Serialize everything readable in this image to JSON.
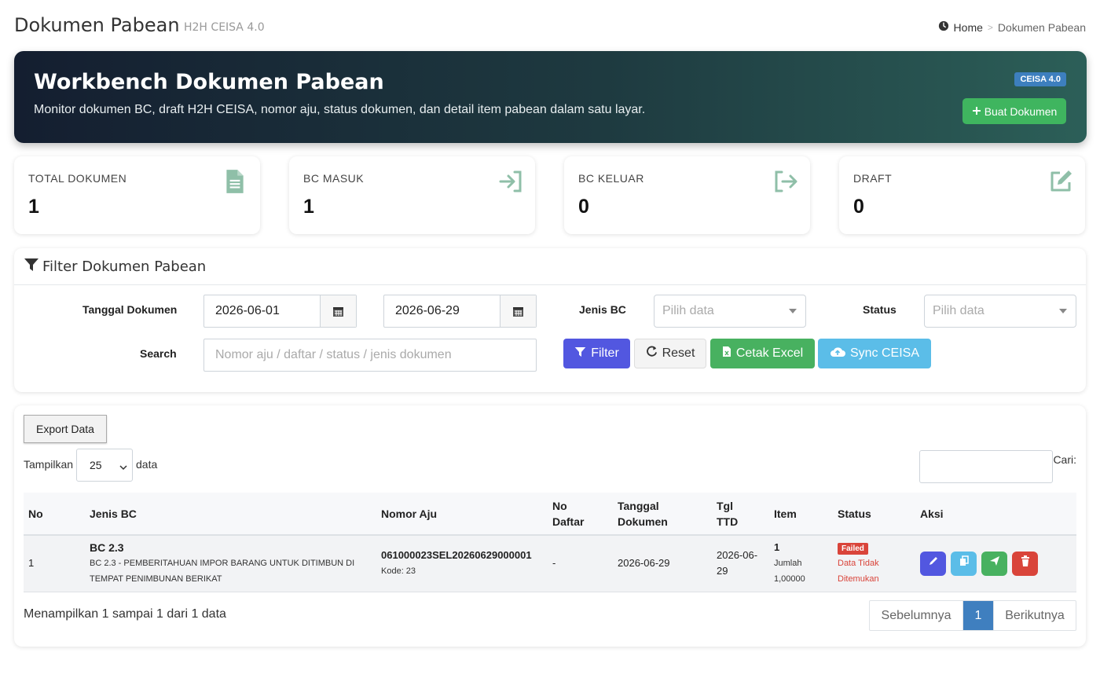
{
  "header": {
    "title": "Dokumen Pabean",
    "subtitle": "H2H CEISA 4.0",
    "breadcrumb_home": "Home",
    "breadcrumb_current": "Dokumen Pabean"
  },
  "hero": {
    "title": "Workbench Dokumen Pabean",
    "description": "Monitor dokumen BC, draft H2H CEISA, nomor aju, status dokumen, dan detail item pabean dalam satu layar.",
    "badge": "CEISA 4.0",
    "create_button": "Buat Dokumen"
  },
  "stats": [
    {
      "label": "TOTAL DOKUMEN",
      "value": "1",
      "icon": "file-icon"
    },
    {
      "label": "BC MASUK",
      "value": "1",
      "icon": "sign-in-icon"
    },
    {
      "label": "BC KELUAR",
      "value": "0",
      "icon": "sign-out-icon"
    },
    {
      "label": "DRAFT",
      "value": "0",
      "icon": "edit-icon"
    }
  ],
  "filter": {
    "title": "Filter Dokumen Pabean",
    "date_label": "Tanggal Dokumen",
    "date_from": "2026-06-01",
    "date_to": "2026-06-29",
    "jenis_label": "Jenis BC",
    "jenis_placeholder": "Pilih data",
    "status_label": "Status",
    "status_placeholder": "Pilih data",
    "search_label": "Search",
    "search_placeholder": "Nomor aju / daftar / status / jenis dokumen",
    "btn_filter": "Filter",
    "btn_reset": "Reset",
    "btn_excel": "Cetak Excel",
    "btn_sync": "Sync CEISA"
  },
  "table": {
    "export_label": "Export Data",
    "show_label": "Tampilkan",
    "page_length": "25",
    "show_suffix": "data",
    "search_label": "Cari:",
    "columns": {
      "no": "No",
      "jenis": "Jenis BC",
      "aju": "Nomor Aju",
      "daftar_1": "No",
      "daftar_2": "Daftar",
      "tgl_1": "Tanggal",
      "tgl_2": "Dokumen",
      "ttd_1": "Tgl",
      "ttd_2": "TTD",
      "item": "Item",
      "status": "Status",
      "aksi": "Aksi"
    },
    "rows": [
      {
        "no": "1",
        "jenis_code": "BC 2.3",
        "jenis_desc": "BC 2.3 - PEMBERITAHUAN IMPOR BARANG UNTUK DITIMBUN DI TEMPAT PENIMBUNAN BERIKAT",
        "aju": "061000023SEL20260629000001",
        "kode": "Kode: 23",
        "daftar": "-",
        "tanggal": "2026-06-29",
        "ttd_1": "2026-06-",
        "ttd_2": "29",
        "item_count": "1",
        "item_label": "Jumlah",
        "item_qty": "1,00000",
        "status_badge": "Failed",
        "status_text_1": "Data Tidak",
        "status_text_2": "Ditemukan"
      }
    ],
    "info": "Menampilkan 1 sampai 1 dari 1 data",
    "pager": {
      "prev": "Sebelumnya",
      "current": "1",
      "next": "Berikutnya"
    }
  },
  "colors": {
    "hero_start": "#141e30",
    "hero_end": "#2c5f58",
    "accent_green": "#3fb55f",
    "filter_blue": "#5257e0",
    "sync_blue": "#5bbde8",
    "danger": "#d9443a",
    "stat_icon": "#8fbfa8"
  }
}
